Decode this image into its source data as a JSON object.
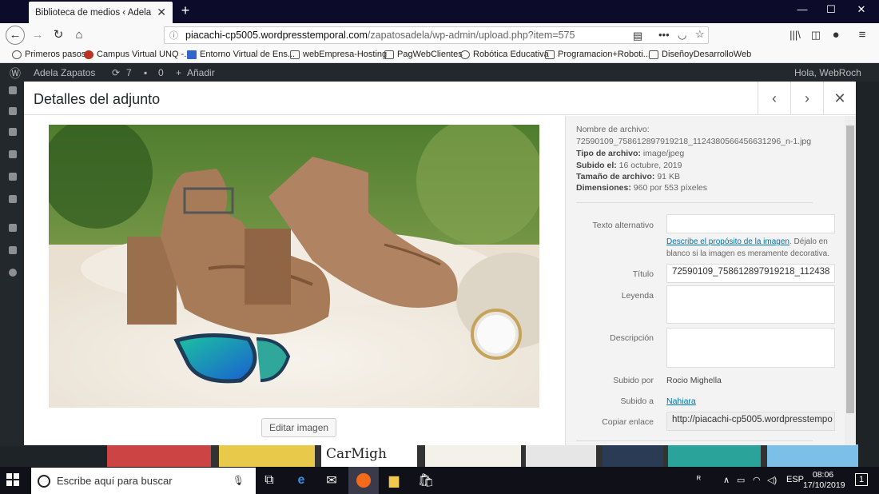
{
  "browser": {
    "tab_title": "Biblioteca de medios ‹ Adela Zapatos",
    "url_host": "piacachi-cp5005.wordpresstemporal.com",
    "url_path": "/zapatosadela/wp-admin/upload.php?item=575",
    "bookmarks": [
      {
        "label": "Primeros pasos",
        "icon": "globe-icon"
      },
      {
        "label": "Campus Virtual UNQ -...",
        "icon": "unq-icon"
      },
      {
        "label": "Entorno Virtual de Ens...",
        "icon": "entorno-icon"
      },
      {
        "label": "webEmpresa-Hosting",
        "icon": "folder-icon"
      },
      {
        "label": "PagWebClientes",
        "icon": "folder-icon"
      },
      {
        "label": "Robótica Educativa",
        "icon": "globe-icon"
      },
      {
        "label": "Programacion+Roboti...",
        "icon": "folder-icon"
      },
      {
        "label": "DiseñoyDesarrolloWeb",
        "icon": "folder-icon"
      }
    ]
  },
  "adminbar": {
    "site_name": "Adela Zapatos",
    "updates": "7",
    "comments": "0",
    "new_label": "Añadir",
    "greeting": "Hola, WebRoch"
  },
  "modal": {
    "title": "Detalles del adjunto",
    "edit_image_label": "Editar imagen",
    "meta": {
      "filename_label": "Nombre de archivo:",
      "filename": "72590109_758612897919218_1124380566456631296_n-1.jpg",
      "filetype_label": "Tipo de archivo:",
      "filetype": "image/jpeg",
      "uploaded_label": "Subido el:",
      "uploaded": "16 octubre, 2019",
      "filesize_label": "Tamaño de archivo:",
      "filesize": "91 KB",
      "dimensions_label": "Dimensiones:",
      "dimensions": "960 por 553 píxeles"
    },
    "fields": {
      "alt_label": "Texto alternativo",
      "alt_value": "",
      "alt_help_link": "Describe el propósito de la imagen",
      "alt_help_text": ". Déjalo en blanco si la imagen es meramente decorativa.",
      "title_label": "Título",
      "title_value": "72590109_758612897919218_112438",
      "caption_label": "Leyenda",
      "caption_value": "",
      "description_label": "Descripción",
      "description_value": "",
      "uploaded_by_label": "Subido por",
      "uploaded_by": "Rocio Mighella",
      "uploaded_to_label": "Subido a",
      "uploaded_to": "Nahiara",
      "copy_link_label": "Copiar enlace",
      "copy_link_value": "http://piacachi-cp5005.wordpresstempo"
    }
  },
  "background_text": "CarMigh",
  "taskbar": {
    "search_placeholder": "Escribe aquí para buscar",
    "language": "ESP",
    "time": "08:06",
    "date": "17/10/2019",
    "notifications": "1"
  }
}
